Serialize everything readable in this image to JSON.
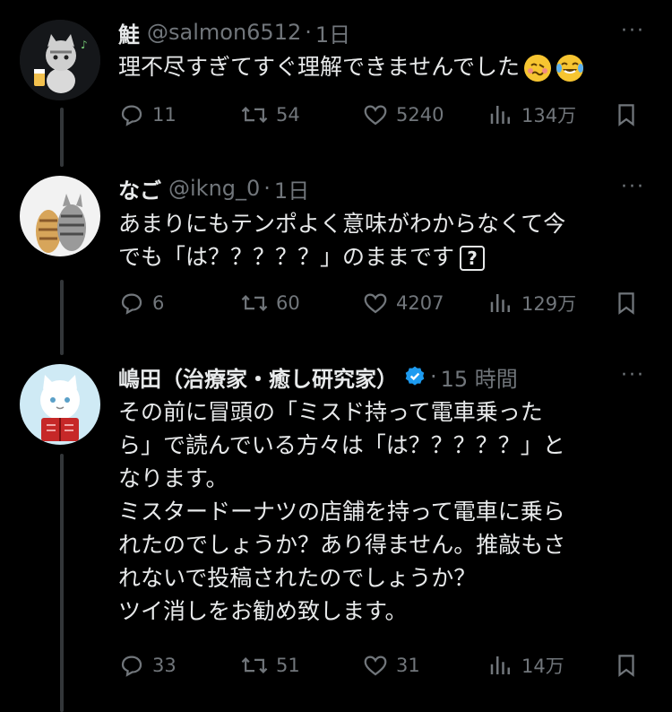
{
  "tweets": [
    {
      "name": "鮭",
      "handle": "@salmon6512",
      "time": "1日",
      "text_lines": [
        "理不尽すぎてすぐ理解できませんでした"
      ],
      "reply_count": "11",
      "retweet_count": "54",
      "like_count": "5240",
      "view_count": "134万"
    },
    {
      "name": "なご",
      "handle": "@ikng_0",
      "time": "1日",
      "text_lines": [
        "あまりにもテンポよく意味がわからなくて今",
        "でも「は？？？？？」のままです"
      ],
      "reply_count": "6",
      "retweet_count": "60",
      "like_count": "4207",
      "view_count": "129万"
    },
    {
      "name": "嶋田（治療家・癒し研究家）",
      "handle": "",
      "time": "15 時間",
      "text_lines": [
        "その前に冒頭の「ミスド持って電車乗った",
        "ら」で読んでいる方々は「は？？？？？」と",
        "なります。",
        "ミスタードーナツの店舗を持って電車に乗ら",
        "れたのでしょうか？あり得ません。推敲もさ",
        "れないで投稿されたのでしょうか？",
        "ツイ消しをお勧め致します。"
      ],
      "reply_count": "33",
      "retweet_count": "51",
      "like_count": "31",
      "view_count": "14万"
    }
  ],
  "dot": "·",
  "more": "···",
  "qbox": "?",
  "colors": {
    "muted": "#71767b",
    "text": "#e7e9ea",
    "verified": "#1d9bf0",
    "line": "#333639"
  },
  "icons": [
    "reply-icon",
    "retweet-icon",
    "like-icon",
    "views-icon",
    "bookmark-icon",
    "more-icon",
    "verified-icon"
  ]
}
